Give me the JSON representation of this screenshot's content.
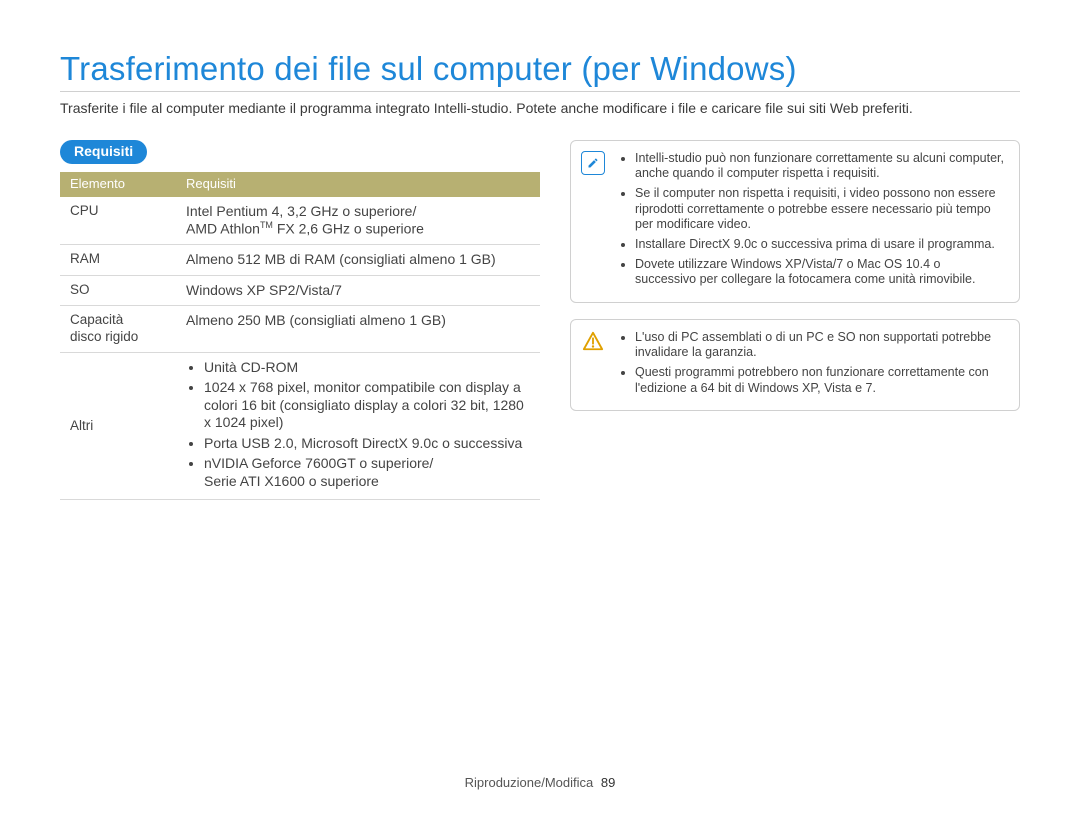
{
  "title": "Trasferimento dei file sul computer (per Windows)",
  "intro": "Trasferite i file al computer mediante il programma integrato Intelli-studio. Potete anche modificare i file e caricare file sui siti Web preferiti.",
  "section_label": "Requisiti",
  "table": {
    "headers": {
      "col1": "Elemento",
      "col2": "Requisiti"
    },
    "rows": {
      "cpu": {
        "label": "CPU",
        "line1": "Intel Pentium 4, 3,2 GHz o superiore/",
        "line2_pre": "AMD Athlon",
        "line2_sup": "TM",
        "line2_post": " FX 2,6 GHz o superiore"
      },
      "ram": {
        "label": "RAM",
        "value": "Almeno 512 MB di RAM (consigliati almeno 1 GB)"
      },
      "so": {
        "label": "SO",
        "value": "Windows XP SP2/Vista/7"
      },
      "hdd": {
        "label_l1": "Capacità",
        "label_l2": "disco rigido",
        "value": "Almeno 250 MB (consigliati almeno 1 GB)"
      },
      "altri": {
        "label": "Altri",
        "items": {
          "0": "Unità CD-ROM",
          "1": "1024 x 768 pixel, monitor compatibile con display a colori 16 bit (consigliato display a colori 32 bit, 1280 x 1024 pixel)",
          "2": "Porta USB 2.0, Microsoft DirectX 9.0c o successiva",
          "3_l1": "nVIDIA Geforce 7600GT o superiore/",
          "3_l2": "Serie ATI X1600 o superiore"
        }
      }
    }
  },
  "info_notes": {
    "0": "Intelli-studio può non funzionare correttamente su alcuni computer, anche quando il computer rispetta i requisiti.",
    "1": "Se il computer non rispetta i requisiti, i video possono non essere riprodotti correttamente o potrebbe essere necessario più tempo per modificare video.",
    "2": "Installare DirectX 9.0c o successiva prima di usare il programma.",
    "3": "Dovete utilizzare Windows XP/Vista/7 o Mac OS 10.4 o successivo per collegare la fotocamera come unità rimovibile."
  },
  "warn_notes": {
    "0": "L'uso di PC assemblati o di un PC e SO non supportati potrebbe invalidare la garanzia.",
    "1": "Questi programmi potrebbero non funzionare correttamente con l'edizione a 64 bit di Windows XP, Vista e 7."
  },
  "footer": {
    "section": "Riproduzione/Modifica",
    "page": "89"
  },
  "chart_data": {
    "type": "table",
    "title": "Requisiti",
    "columns": [
      "Elemento",
      "Requisiti"
    ],
    "rows": [
      [
        "CPU",
        "Intel Pentium 4, 3,2 GHz o superiore / AMD Athlon™ FX 2,6 GHz o superiore"
      ],
      [
        "RAM",
        "Almeno 512 MB di RAM (consigliati almeno 1 GB)"
      ],
      [
        "SO",
        "Windows XP SP2/Vista/7"
      ],
      [
        "Capacità disco rigido",
        "Almeno 250 MB (consigliati almeno 1 GB)"
      ],
      [
        "Altri",
        "Unità CD-ROM; 1024 x 768 pixel, monitor compatibile con display a colori 16 bit (consigliato display a colori 32 bit, 1280 x 1024 pixel); Porta USB 2.0, Microsoft DirectX 9.0c o successiva; nVIDIA Geforce 7600GT o superiore / Serie ATI X1600 o superiore"
      ]
    ]
  }
}
